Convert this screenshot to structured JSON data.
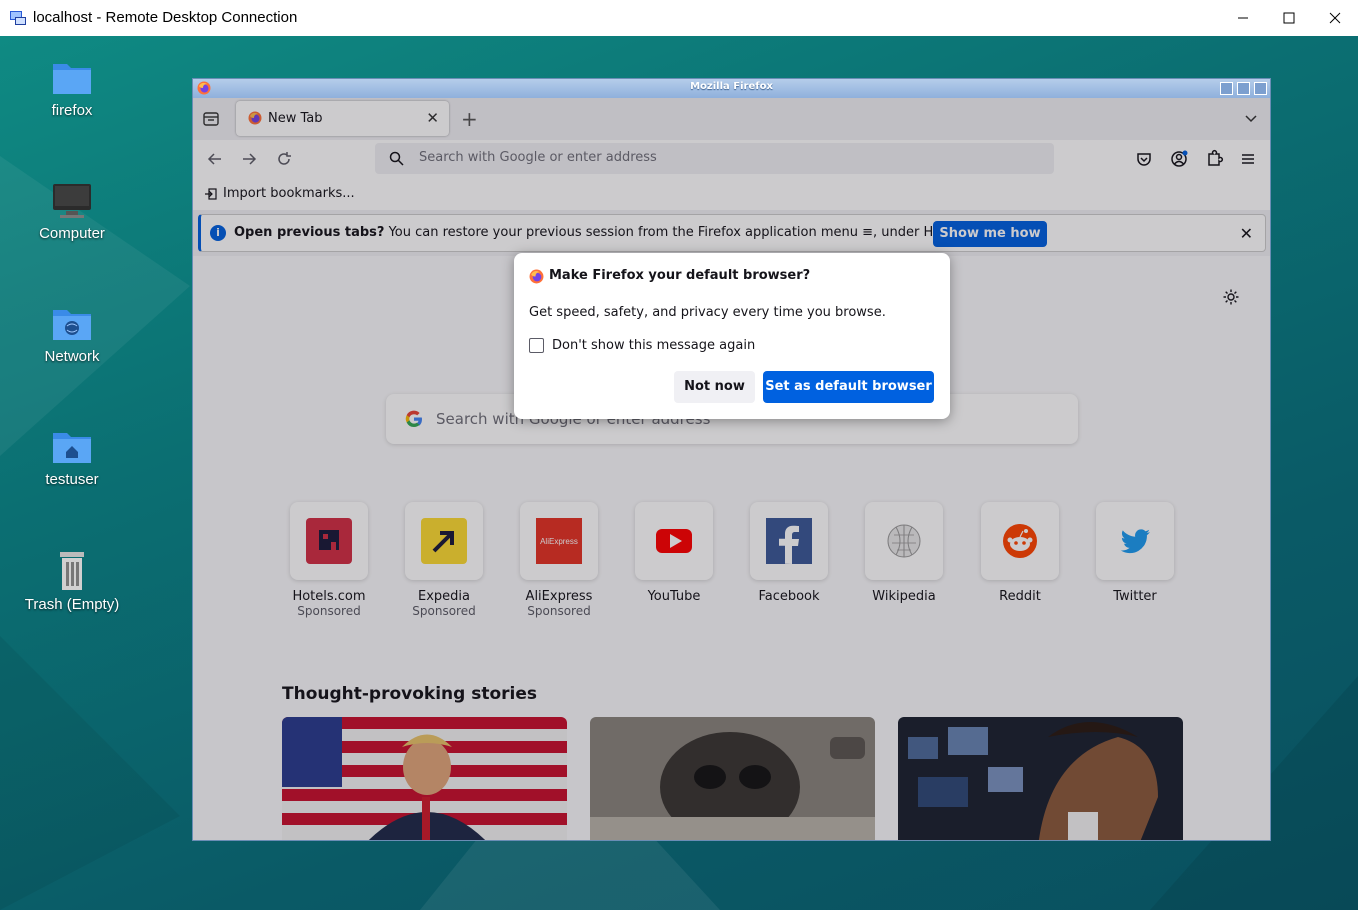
{
  "rdp": {
    "title": "localhost - Remote Desktop Connection",
    "minimize": "—",
    "maximize": "☐",
    "close": "✕"
  },
  "desktop": {
    "icons": [
      {
        "label": "firefox",
        "icon": "folder-icon"
      },
      {
        "label": "Computer",
        "icon": "monitor-icon"
      },
      {
        "label": "Network",
        "icon": "network-folder-icon"
      },
      {
        "label": "testuser",
        "icon": "home-folder-icon"
      },
      {
        "label": "Trash (Empty)",
        "icon": "trash-icon"
      }
    ]
  },
  "firefox": {
    "wm_title": "Mozilla Firefox",
    "tab": {
      "label": "New Tab",
      "close": "✕"
    },
    "new_tab": "+",
    "url_placeholder": "Search with Google or enter address",
    "bookmarks": {
      "import_label": "Import bookmarks..."
    },
    "notification": {
      "bold": "Open previous tabs?",
      "text": " You can restore your previous session from the Firefox application menu ",
      "menu_glyph": "≡",
      "suffix": ", under History.",
      "button": "Show me how",
      "close": "✕"
    },
    "newtab": {
      "search_placeholder": "Search with Google or enter address",
      "tiles": [
        {
          "name": "Hotels.com",
          "sponsored": "Sponsored"
        },
        {
          "name": "Expedia",
          "sponsored": "Sponsored"
        },
        {
          "name": "AliExpress",
          "sponsored": "Sponsored",
          "logo_text": "AliExpress"
        },
        {
          "name": "YouTube",
          "sponsored": ""
        },
        {
          "name": "Facebook",
          "sponsored": ""
        },
        {
          "name": "Wikipedia",
          "sponsored": ""
        },
        {
          "name": "Reddit",
          "sponsored": ""
        },
        {
          "name": "Twitter",
          "sponsored": ""
        }
      ],
      "stories_title": "Thought-provoking stories"
    },
    "dialog": {
      "title": "Make Firefox your default browser?",
      "message": "Get speed, safety, and privacy every time you browse.",
      "checkbox_label": "Don't show this message again",
      "checkbox_checked": false,
      "secondary_button": "Not now",
      "primary_button": "Set as default browser"
    }
  },
  "colors": {
    "accent": "#0061e0",
    "desktop_bg": "#0b6f72"
  }
}
